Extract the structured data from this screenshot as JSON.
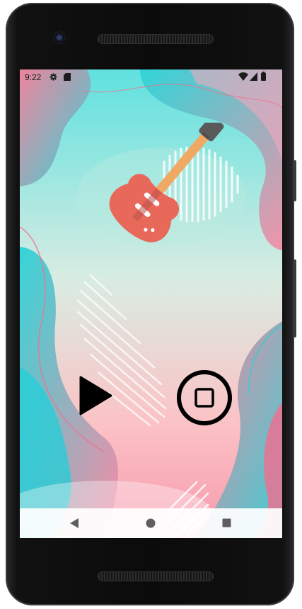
{
  "status_bar": {
    "time": "9:22",
    "icons": [
      "gear-icon",
      "sd-card-icon",
      "wifi-icon",
      "signal-icon",
      "battery-icon"
    ]
  },
  "player": {
    "controls": [
      {
        "name": "play-button",
        "icon": "play-icon"
      },
      {
        "name": "stop-button",
        "icon": "stop-icon"
      }
    ],
    "artwork": "guitar-illustration"
  },
  "nav_bar": {
    "buttons": [
      "back-icon",
      "home-icon",
      "recents-icon"
    ]
  },
  "colors": {
    "accent_teal": "#2cd3d6",
    "accent_pink": "#f48aa0",
    "guitar_body": "#e8685a",
    "guitar_neck": "#efa964",
    "control": "#000000"
  }
}
